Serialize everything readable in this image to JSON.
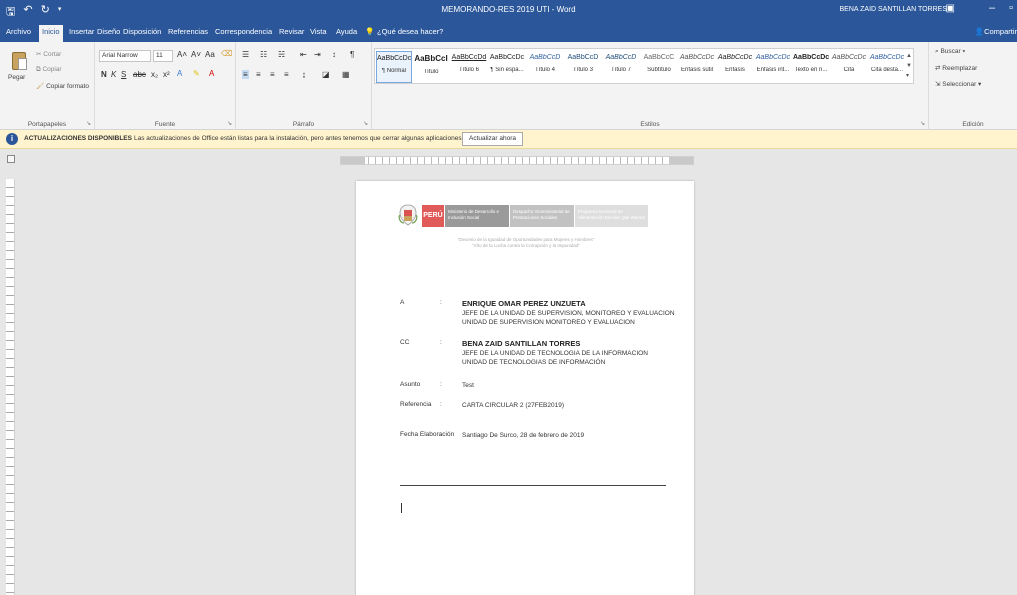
{
  "window": {
    "title": "MEMORANDO-RES 2019 UTI  -  Word",
    "user": "BENA ZAID SANTILLAN TORRES",
    "minimize": "–",
    "restore": "▫"
  },
  "tabs": [
    {
      "label": "Archivo"
    },
    {
      "label": "Inicio"
    },
    {
      "label": "Insertar"
    },
    {
      "label": "Diseño"
    },
    {
      "label": "Disposición"
    },
    {
      "label": "Referencias"
    },
    {
      "label": "Correspondencia"
    },
    {
      "label": "Revisar"
    },
    {
      "label": "Vista"
    },
    {
      "label": "Ayuda"
    },
    {
      "label": "¿Qué desea hacer?"
    }
  ],
  "share": "Compartir",
  "ribbon": {
    "clipboard": {
      "label": "Portapapeles",
      "paste": "Pegar",
      "cut": "Cortar",
      "copy": "Copiar",
      "format_painter": "Copiar formato"
    },
    "font": {
      "label": "Fuente",
      "font_name": "Arial Narrow",
      "font_size": "11"
    },
    "paragraph": {
      "label": "Párrafo"
    },
    "styles": {
      "label": "Estilos",
      "items": [
        {
          "sample": "AaBbCcDc",
          "name": "¶ Normal"
        },
        {
          "sample": "AaBbCcI",
          "name": "Título"
        },
        {
          "sample": "AaBbCcDd",
          "name": "Título 6"
        },
        {
          "sample": "AaBbCcDc",
          "name": "¶ Sin espa..."
        },
        {
          "sample": "AaBbCcD",
          "name": "Título 4"
        },
        {
          "sample": "AaBbCcD",
          "name": "Título 3"
        },
        {
          "sample": "AaBbCcD",
          "name": "Título 7"
        },
        {
          "sample": "AaBbCcC",
          "name": "Subtítulo"
        },
        {
          "sample": "AaBbCcDc",
          "name": "Énfasis sutil"
        },
        {
          "sample": "AaBbCcDc",
          "name": "Énfasis"
        },
        {
          "sample": "AaBbCcDc",
          "name": "Énfasis int..."
        },
        {
          "sample": "AaBbCcDc",
          "name": "Texto en n..."
        },
        {
          "sample": "AaBbCcDc",
          "name": "Cita"
        },
        {
          "sample": "AaBbCcDc",
          "name": "Cita desta..."
        }
      ]
    },
    "editing": {
      "label": "Edición",
      "find": "Buscar",
      "replace": "Reemplazar",
      "select": "Seleccionar"
    }
  },
  "infobar": {
    "title": "ACTUALIZACIONES DISPONIBLES",
    "message": "Las actualizaciones de Office están listas para la instalación, pero antes tenemos que cerrar algunas aplicaciones.",
    "button": "Actualizar ahora"
  },
  "document": {
    "logo": {
      "peru": "PERÚ",
      "box1": "Ministerio de Desarrollo e Inclusión Social",
      "box2": "Despacho Viceministerial de Prestaciones Sociales",
      "box3": "Programa Nacional de Alimentación Escolar Qali Warma"
    },
    "slogan_line1": "\"Decenio de la Igualdad de Oportunidades para Mujeres y Hombres\"",
    "slogan_line2": "\"Año de la Lucha contra la Corrupción y la Impunidad\"",
    "memo": [
      {
        "label": "A",
        "lines": [
          "ENRIQUE OMAR PEREZ UNZUETA",
          "JEFE DE LA UNIDAD DE SUPERVISION, MONITOREO Y EVALUACION",
          "UNIDAD DE SUPERVISION MONITOREO Y EVALUACION"
        ]
      },
      {
        "label": "CC",
        "lines": [
          "BENA ZAID SANTILLAN TORRES",
          "JEFE DE LA UNIDAD DE TECNOLOGIA DE LA INFORMACION",
          "UNIDAD DE TECNOLOGIAS DE INFORMACIÓN"
        ]
      },
      {
        "label": "Asunto",
        "lines": [
          "Test"
        ]
      },
      {
        "label": "Referencia",
        "lines": [
          "CARTA CIRCULAR 2 (27FEB2019)"
        ]
      },
      {
        "label": "Fecha Elaboración",
        "lines": [
          "Santiago De Surco, 28 de febrero de 2019"
        ]
      }
    ]
  }
}
